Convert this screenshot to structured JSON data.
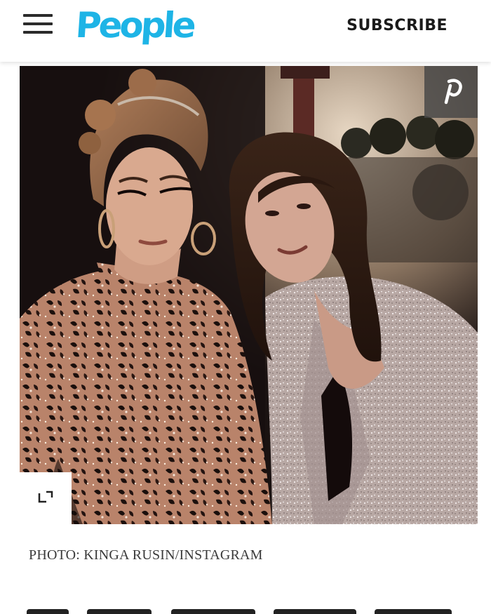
{
  "header": {
    "logo_text": "People",
    "subscribe_label": "SUBSCRIBE"
  },
  "icons": {
    "menu": "hamburger-icon",
    "pinterest": "pinterest-icon",
    "expand": "expand-icon"
  },
  "photo": {
    "caption": "PHOTO: KINGA RUSIN/INSTAGRAM"
  },
  "colors": {
    "brand": "#1eb4e6",
    "header_text": "#1a1a1a"
  }
}
